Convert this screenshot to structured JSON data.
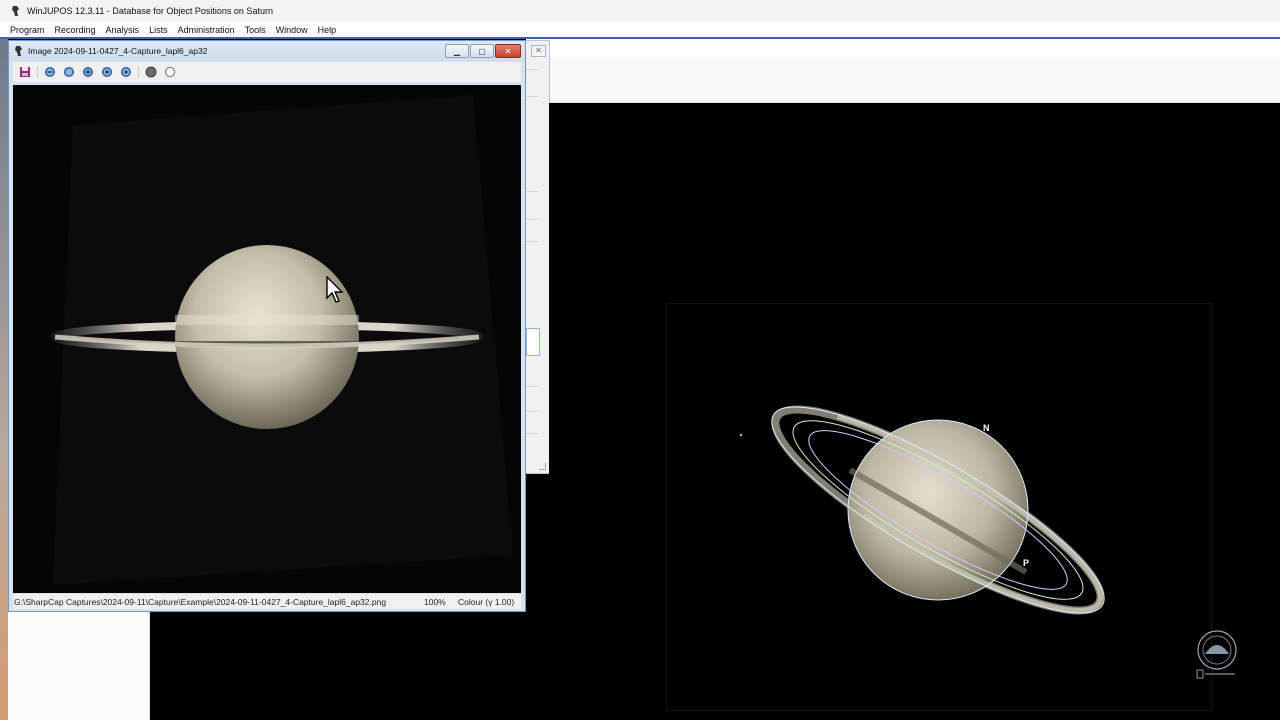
{
  "app": {
    "title": "WinJUPOS 12.3.11 - Database for Object Positions on Saturn",
    "icon": "winjupos-app-icon"
  },
  "menu": [
    "Program",
    "Recording",
    "Analysis",
    "Lists",
    "Administration",
    "Tools",
    "Window",
    "Help"
  ],
  "image_window": {
    "title": "Image  2024-09-11-0427_4-Capture_lapl6_ap32",
    "toolbar": {
      "icons": [
        "save-icon",
        "zoom-out-icon",
        "zoom-fit-icon",
        "zoom-in-icon",
        "zoom-step-icon",
        "zoom-reset-icon",
        "mode-filled-icon",
        "mode-empty-icon"
      ]
    },
    "status": {
      "path": "G:\\SharpCap Captures\\2024-09-11\\Capture\\Example\\2024-09-11-0427_4-Capture_lapl6_ap32.png",
      "zoom": "100%",
      "colour": "Colour (γ 1.00)"
    }
  },
  "outline": {
    "north_label": "N",
    "pole_label": "P"
  },
  "colors": {
    "accent_blue": "#3c62b0",
    "outline": "#cfe3f5",
    "planet": "#d9d2bf"
  }
}
